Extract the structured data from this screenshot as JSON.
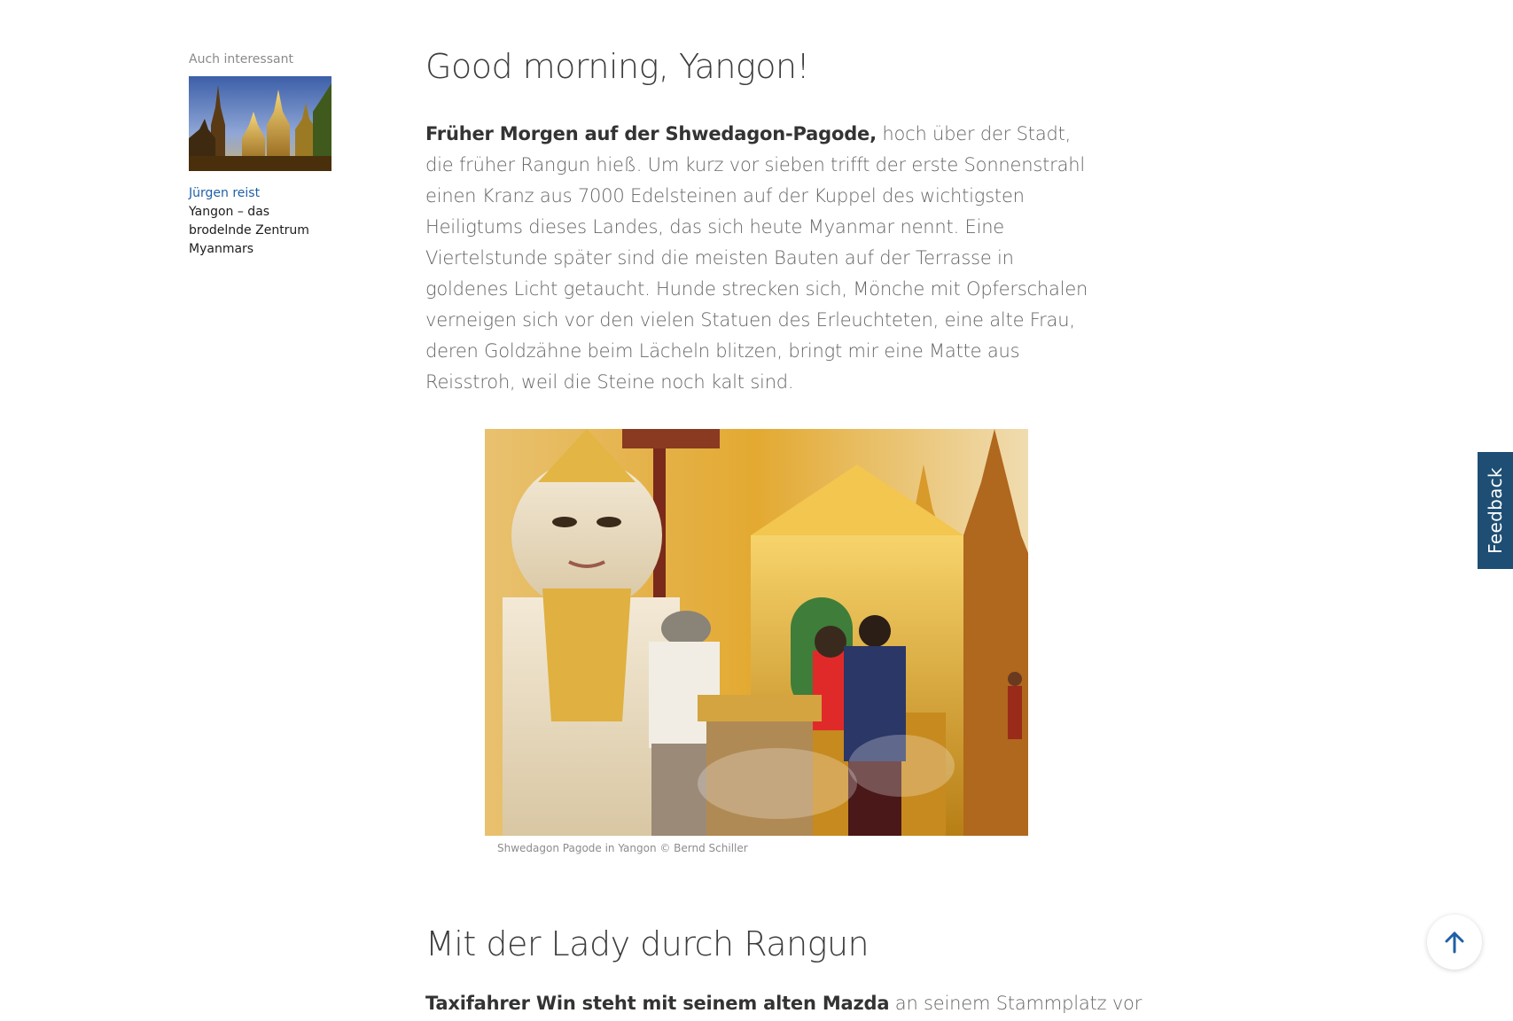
{
  "sidebar": {
    "heading": "Auch interessant",
    "teaser": {
      "author": "Jürgen reist",
      "title": "Yangon – das brodelnde Zentrum Myanmars"
    }
  },
  "article": {
    "title": "Good morning, Yangon!",
    "intro": {
      "lead": "Früher Morgen auf der Shwedagon-Pagode,",
      "text": " hoch über der Stadt, die früher Rangun hieß. Um kurz vor sieben trifft der erste Sonnenstrahl einen Kranz aus 7000 Edelsteinen auf der Kuppel des wichtigsten Heiligtums dieses Landes, das sich heute Myanmar nennt. Eine Viertelstunde später sind die meisten Bauten auf der Terrasse in goldenes Licht getaucht. Hunde strecken sich, Mönche mit Opferschalen verneigen sich vor den vielen Statuen des Erleuchteten, eine alte Frau, deren Goldzähne beim Lächeln blitzen, bringt mir eine Matte aus Reisstroh, weil die Steine noch kalt sind."
    },
    "figure": {
      "caption": "Shwedagon Pagode in Yangon © Bernd Schiller"
    },
    "section": {
      "heading": "Mit der Lady durch Rangun",
      "lead": "Taxifahrer Win steht mit seinem alten Mazda",
      "text": " an seinem Stammplatz vor"
    }
  },
  "feedback": {
    "label": "Feedback"
  },
  "icons": {
    "back_to_top": "arrow-up-icon"
  },
  "colors": {
    "link": "#1f5fa6",
    "feedback_bg": "#1e4e73",
    "arrow": "#1f5fa6"
  }
}
